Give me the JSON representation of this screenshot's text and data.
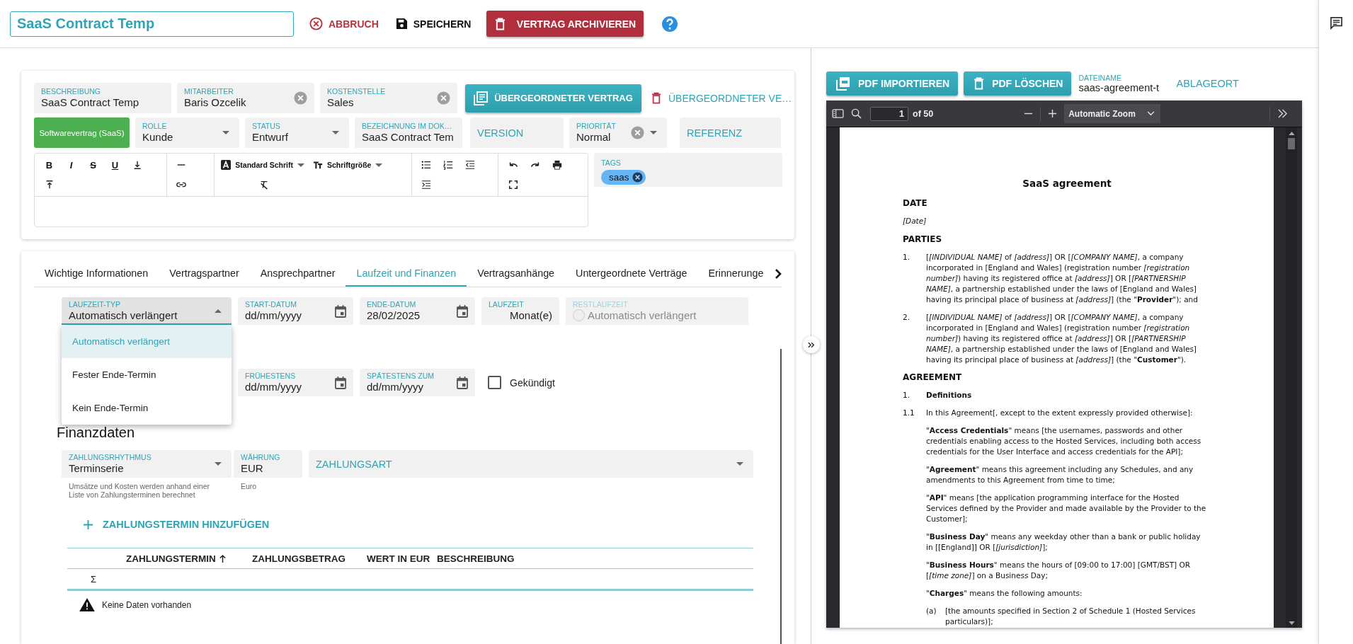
{
  "header": {
    "title": "SaaS Contract Temp",
    "cancel": "ABBRUCH",
    "save": "SPEICHERN",
    "archive": "VERTRAG ARCHIVIEREN"
  },
  "contract": {
    "fields_top": [
      {
        "kind": "text",
        "label": "BESCHREIBUNG",
        "value": "SaaS Contract Temp"
      },
      {
        "kind": "clearable",
        "label": "MITARBEITER",
        "value": "Baris Ozcelik"
      },
      {
        "kind": "clearable",
        "label": "KOSTENSTELLE",
        "value": "Sales"
      }
    ],
    "parent_contract_button": "ÜBERGEORDNETER VERTRAG",
    "remove_parent_button": "ÜBERGEORDNETER VE…",
    "contract_type": "Softwarevertrag (SaaS)",
    "fields_second": [
      {
        "kind": "select",
        "label": "ROLLE",
        "value": "Kunde"
      },
      {
        "kind": "select",
        "label": "STATUS",
        "value": "Entwurf"
      },
      {
        "kind": "text",
        "label": "BEZEICHNUNG IM DOK…",
        "value": "SaaS Contract Tem"
      },
      {
        "kind": "empty",
        "placeholder": "VERSION"
      },
      {
        "kind": "clearable-select",
        "label": "PRIORITÄT",
        "value": "Normal"
      },
      {
        "kind": "empty",
        "placeholder": "REFERENZ"
      }
    ],
    "editor": {
      "groups": [
        [
          {
            "kind": "bold",
            "label": "B"
          },
          {
            "kind": "italic",
            "label": "I"
          },
          {
            "kind": "strike",
            "label": "S"
          },
          {
            "kind": "underline",
            "label": "U"
          },
          {
            "kind": "align-bottom"
          },
          {
            "kind": "align-top"
          }
        ],
        [
          {
            "kind": "rule"
          },
          {
            "kind": "link"
          }
        ],
        [
          {
            "kind": "font",
            "label": "Standard Schrift"
          },
          {
            "kind": "size",
            "label": "Schriftgröße"
          },
          {
            "kind": "clear-format"
          }
        ],
        [
          {
            "kind": "bullets"
          },
          {
            "kind": "numbers"
          },
          {
            "kind": "outdent"
          },
          {
            "kind": "indent"
          }
        ],
        [
          {
            "kind": "undo"
          },
          {
            "kind": "redo"
          },
          {
            "kind": "print"
          },
          {
            "kind": "fullscreen"
          }
        ]
      ]
    },
    "tags": {
      "label": "TAGS",
      "chips": [
        "saas"
      ]
    }
  },
  "tabs": [
    {
      "label": "Wichtige Informationen",
      "selected": false
    },
    {
      "label": "Vertragspartner",
      "selected": false
    },
    {
      "label": "Ansprechpartner",
      "selected": false
    },
    {
      "label": "Laufzeit und Finanzen",
      "selected": true
    },
    {
      "label": "Vertragsanhänge",
      "selected": false
    },
    {
      "label": "Untergeordnete Verträge",
      "selected": false
    },
    {
      "label": "Erinnerunge",
      "selected": false
    }
  ],
  "term": {
    "fields": [
      {
        "kind": "select",
        "label": "LAUFZEIT-TYP",
        "value": "Automatisch verlängert",
        "open": true,
        "options": [
          {
            "label": "Automatisch verlängert",
            "selected": true
          },
          {
            "label": "Fester Ende-Termin",
            "selected": false
          },
          {
            "label": "Kein Ende-Termin",
            "selected": false
          }
        ]
      },
      {
        "kind": "date",
        "label": "START-DATUM",
        "placeholder": "dd/mm/yyyy"
      },
      {
        "kind": "date",
        "label": "ENDE-DATUM",
        "value": "28/02/2025"
      },
      {
        "kind": "unit",
        "label": "LAUFZEIT",
        "value": "Monat(e)"
      },
      {
        "kind": "radio",
        "label": "RESTLAUFZEIT",
        "value": "Automatisch verlängert",
        "disabled": true
      }
    ],
    "fields_second": [
      {
        "kind": "date",
        "label": "FRÜHESTENS",
        "placeholder": "dd/mm/yyyy"
      },
      {
        "kind": "date",
        "label": "SPÄTESTENS ZUM",
        "placeholder": "dd/mm/yyyy"
      },
      {
        "kind": "checkbox",
        "label": "Gekündigt",
        "checked": false
      }
    ]
  },
  "finance": {
    "title": "Finanzdaten",
    "fields": [
      {
        "kind": "select",
        "label": "ZAHLUNGSRHYTHMUS",
        "value": "Terminserie",
        "hint": "Umsätze und Kosten werden anhand einer Liste von Zahlungsterminen berechnet"
      },
      {
        "kind": "text",
        "label": "WÄHRUNG",
        "value": "EUR",
        "hint": "Euro"
      },
      {
        "kind": "empty-select",
        "placeholder": "ZAHLUNGSART"
      }
    ],
    "add_button": "ZAHLUNGSTERMIN HINZUFÜGEN",
    "table": {
      "columns": [
        {
          "label": "ZAHLUNGSTERMIN",
          "sort_ascending": true
        },
        {
          "label": "ZAHLUNGSBETRAG"
        },
        {
          "label": "WERT IN EUR"
        },
        {
          "label": "BESCHREIBUNG"
        }
      ],
      "sum_symbol": "Σ",
      "empty_message": "Keine Daten vorhanden"
    }
  },
  "pdf": {
    "import_button": "PDF IMPORTIEREN",
    "delete_button": "PDF LÖSCHEN",
    "filename_label": "DATEINAME",
    "filename": "saas-agreement-t",
    "location_link": "ABLAGEORT",
    "viewer": {
      "page": "1",
      "page_count": "of 50",
      "zoom": "Automatic Zoom",
      "document": [
        {
          "kind": "title",
          "text": "SaaS agreement"
        },
        {
          "kind": "heading",
          "text": "DATE"
        },
        {
          "kind": "note",
          "text": "[Date]"
        },
        {
          "kind": "heading",
          "text": "PARTIES"
        },
        {
          "kind": "item",
          "num": "1.",
          "text": "[*[INDIVIDUAL NAME]* of *[address]*] OR [*[COMPANY NAME]*, a company incorporated in [England and Wales] (registration number *[registration number]*) having its registered office at *[address]*] OR [*[PARTNERSHIP NAME]*, a partnership established under the laws of [England and Wales] having its principal place of business at *[address]*] (the \"**Provider**\"); and"
        },
        {
          "kind": "item",
          "num": "2.",
          "text": "[*[INDIVIDUAL NAME]* of *[address]*] OR [*[COMPANY NAME]*, a company incorporated in [England and Wales] (registration number *[registration number]*) having its registered office at *[address]*] OR [*[PARTNERSHIP NAME]*, a partnership established under the laws of [England and Wales] having its principal place of business at *[address]*] (the \"**Customer**\")."
        },
        {
          "kind": "heading",
          "text": "AGREEMENT"
        },
        {
          "kind": "clause",
          "num": "1.",
          "text": "Definitions"
        },
        {
          "kind": "item",
          "num": "1.1",
          "text": "In this Agreement[, except to the extent expressly provided otherwise]:"
        },
        {
          "kind": "def",
          "text": "\"**Access Credentials**\" means [the usernames, passwords and other credentials enabling access to the Hosted Services, including both access credentials for the User Interface and access credentials for the API];"
        },
        {
          "kind": "def",
          "text": "\"**Agreement**\" means this agreement including any Schedules, and any amendments to this Agreement from time to time;"
        },
        {
          "kind": "def",
          "text": "\"**API**\" means [the application programming interface for the Hosted Services defined by the Provider and made available by the Provider to the Customer];"
        },
        {
          "kind": "def",
          "text": "\"**Business Day**\" means any weekday other than a bank or public holiday in [[England]] OR [*[jurisdiction]*];"
        },
        {
          "kind": "def",
          "text": "\"**Business Hours**\" means the hours of [09:00 to 17:00] [GMT/BST] OR [*[time zone]*] on a Business Day;"
        },
        {
          "kind": "def",
          "text": "\"**Charges**\" means the following amounts:"
        },
        {
          "kind": "subitem",
          "num": "(a)",
          "text": "[the amounts specified in Section 2 of Schedule 1 (Hosted Services particulars)];"
        }
      ]
    }
  }
}
